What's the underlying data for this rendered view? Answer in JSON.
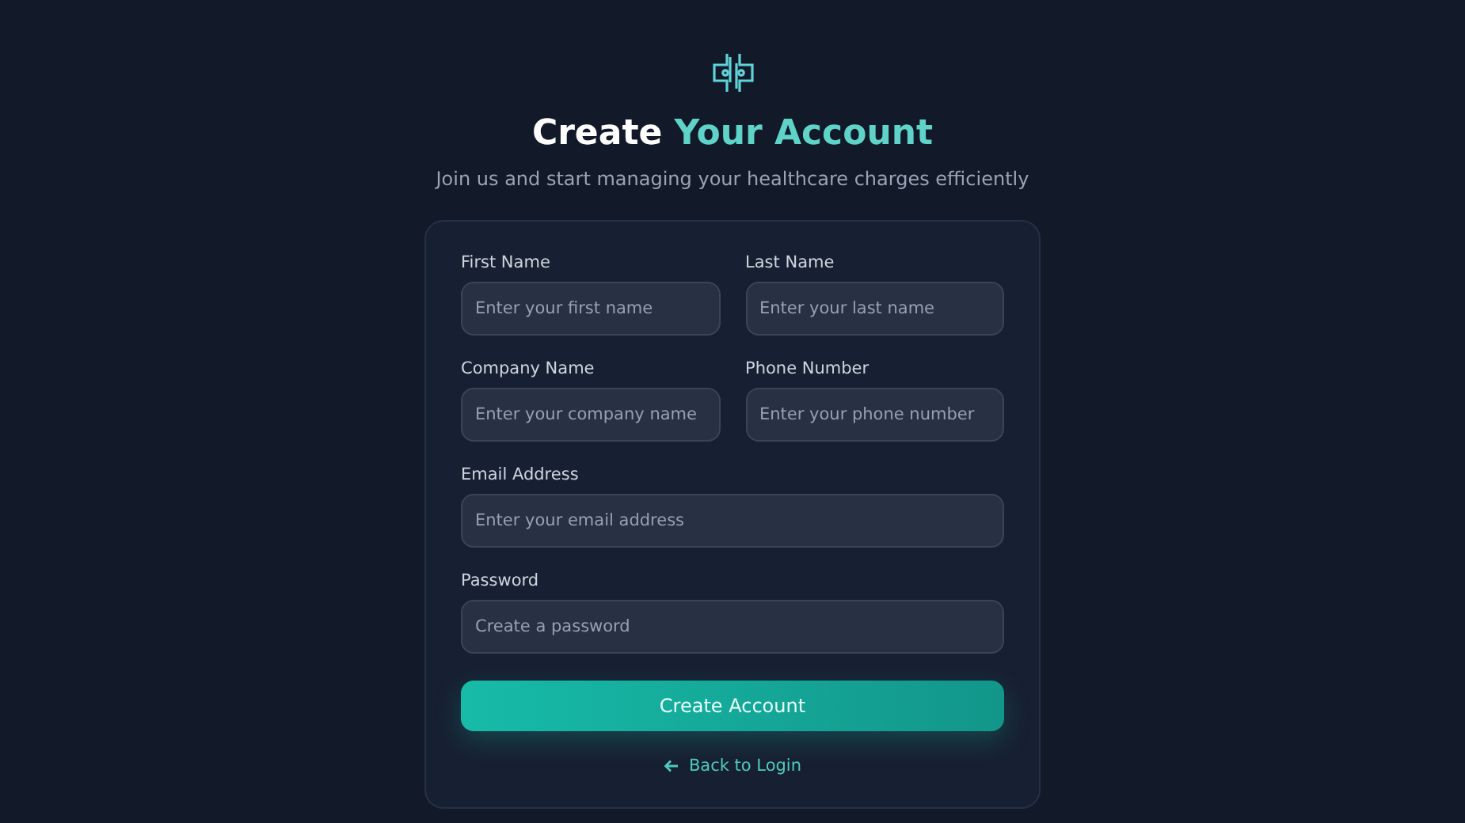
{
  "title": {
    "text": "Create",
    "highlight": "Your Account"
  },
  "subtitle": "Join us and start managing your healthcare charges efficiently",
  "form": {
    "rows": [
      [
        {
          "label": "First Name",
          "placeholder": "Enter your first name"
        },
        {
          "label": "Last Name",
          "placeholder": "Enter your last name"
        }
      ],
      [
        {
          "label": "Company Name",
          "placeholder": "Enter your company name"
        },
        {
          "label": "Phone Number",
          "placeholder": "Enter your phone number"
        }
      ],
      [
        {
          "label": "Email Address",
          "placeholder": "Enter your email address"
        }
      ],
      [
        {
          "label": "Password",
          "placeholder": "Create a password"
        }
      ]
    ],
    "submit": "Create Account",
    "back_link": "Back to Login"
  }
}
